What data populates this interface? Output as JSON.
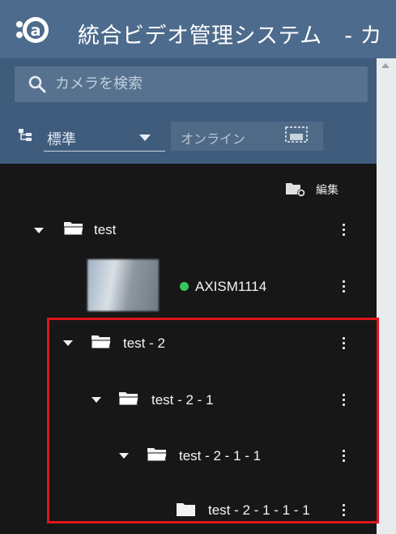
{
  "app": {
    "title": "統合ビデオ管理システム　- カ"
  },
  "search": {
    "placeholder": "カメラを検索"
  },
  "filter": {
    "view_label": "標準",
    "online_label": "オンライン"
  },
  "tree": {
    "edit_label": "編集",
    "nodes": [
      {
        "label": "test"
      },
      {
        "label": "AXISM1114",
        "status": "online"
      },
      {
        "label": "test - 2"
      },
      {
        "label": "test - 2 - 1"
      },
      {
        "label": "test - 2 - 1 - 1"
      },
      {
        "label": "test - 2 - 1 - 1 - 1"
      }
    ]
  },
  "colors": {
    "header": "#4d6b8c",
    "panel": "#3f5c7d",
    "tree_bg": "#171717",
    "online": "#35c759",
    "highlight": "#e0141b"
  }
}
